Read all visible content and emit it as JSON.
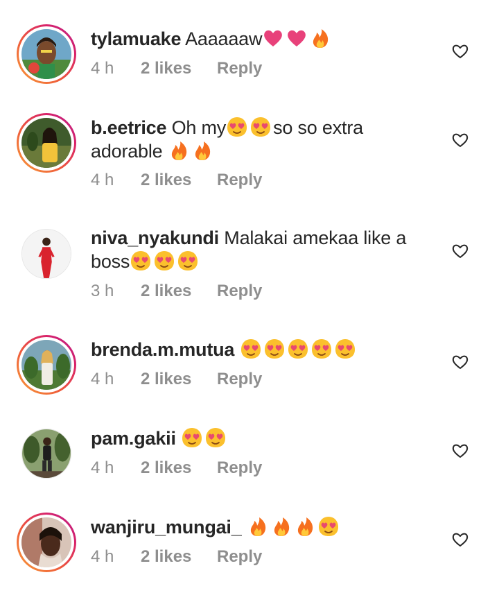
{
  "comments": [
    {
      "username": "tylamuake",
      "text": "Aaaaaaw",
      "emojis": [
        "heart",
        "heart",
        "fire"
      ],
      "time": "4 h",
      "likes": "2 likes",
      "reply": "Reply",
      "story_ring": true
    },
    {
      "username": "b.eetrice",
      "text": "Oh my",
      "emojis_mid": [
        "heart-eyes",
        "heart-eyes"
      ],
      "text2": "so so extra",
      "line2": "adorable",
      "emojis": [
        "fire",
        "fire"
      ],
      "time": "4 h",
      "likes": "2 likes",
      "reply": "Reply",
      "story_ring": true
    },
    {
      "username": "niva_nyakundi",
      "text": "Malakai amekaa like a",
      "line2": "boss",
      "emojis": [
        "heart-eyes",
        "heart-eyes",
        "heart-eyes"
      ],
      "time": "3 h",
      "likes": "2 likes",
      "reply": "Reply",
      "story_ring": false
    },
    {
      "username": "brenda.m.mutua",
      "text": "",
      "emojis": [
        "heart-eyes",
        "heart-eyes",
        "heart-eyes",
        "heart-eyes",
        "heart-eyes"
      ],
      "time": "4 h",
      "likes": "2 likes",
      "reply": "Reply",
      "story_ring": true
    },
    {
      "username": "pam.gakii",
      "text": "",
      "emojis": [
        "heart-eyes",
        "heart-eyes"
      ],
      "time": "4 h",
      "likes": "2 likes",
      "reply": "Reply",
      "story_ring": false
    },
    {
      "username": "wanjiru_mungai_",
      "text": "",
      "emojis": [
        "fire",
        "fire",
        "fire",
        "heart-eyes"
      ],
      "time": "4 h",
      "likes": "2 likes",
      "reply": "Reply",
      "story_ring": true
    }
  ],
  "icons": {
    "like": "heart-outline-icon"
  },
  "colors": {
    "text": "#262626",
    "meta": "#8e8e8e",
    "heart_emoji": "#e8417a",
    "fire": "#f6701f"
  }
}
